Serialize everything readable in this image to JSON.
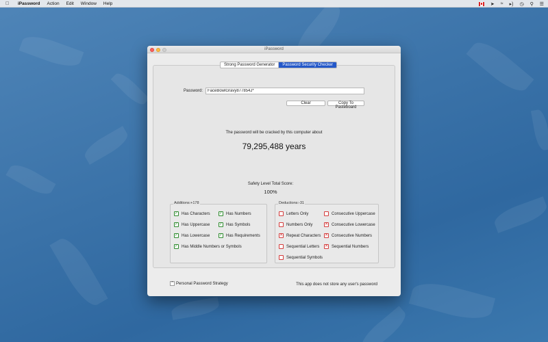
{
  "menubar": {
    "app_name": "iPassword",
    "menus": [
      "Action",
      "Edit",
      "Window",
      "Help"
    ],
    "status_icons": [
      "flag-icon",
      "location-icon",
      "wifi-icon",
      "volume-icon",
      "clock-icon",
      "search-icon",
      "list-icon"
    ]
  },
  "window": {
    "title": "iPassword",
    "tabs": [
      {
        "label": "Strong Password Generator",
        "active": false
      },
      {
        "label": "Password Security Checker",
        "active": true
      }
    ],
    "password_label": "Password:",
    "password_value": "FaceBowlGravy877854J*",
    "clear_label": "Clear",
    "copy_label": "Copy To Pasteboard",
    "crack_text": "The password will be cracked by this computer about",
    "crack_years": "79,295,488 years",
    "score_label": "Safety Level Total Score:",
    "score_value": "100%",
    "additions": {
      "title": "Additions:+178",
      "items": [
        {
          "label": "Has Characters",
          "checked": true
        },
        {
          "label": "Has Numbers",
          "checked": true
        },
        {
          "label": "Has Uppercase",
          "checked": true
        },
        {
          "label": "Has Symbols",
          "checked": true
        },
        {
          "label": "Has Lowercase",
          "checked": true
        },
        {
          "label": "Has Requirements",
          "checked": true
        },
        {
          "label": "Has Middle Numbers or Symbols",
          "checked": true
        }
      ]
    },
    "deductions": {
      "title": "Deductions:-31",
      "items": [
        {
          "label": "Letters Only",
          "marked": false
        },
        {
          "label": "Consecutive Uppercase",
          "marked": false
        },
        {
          "label": "Numbers Only",
          "marked": false
        },
        {
          "label": "Consecutive Lowercase",
          "marked": true
        },
        {
          "label": "Repeat Characters",
          "marked": true
        },
        {
          "label": "Consecutive Numbers",
          "marked": true
        },
        {
          "label": "Sequential Letters",
          "marked": false
        },
        {
          "label": "Sequential Numbers",
          "marked": true
        },
        {
          "label": "Sequential Symbols",
          "marked": false
        }
      ]
    },
    "strategy_label": "Personal Password Strategy",
    "footer_note": "This app does not store any user's password"
  },
  "colors": {
    "accent": "#2458c9",
    "check_green": "#2c8a2c",
    "mark_red": "#d43b3b",
    "desktop": "#3a72a8"
  }
}
